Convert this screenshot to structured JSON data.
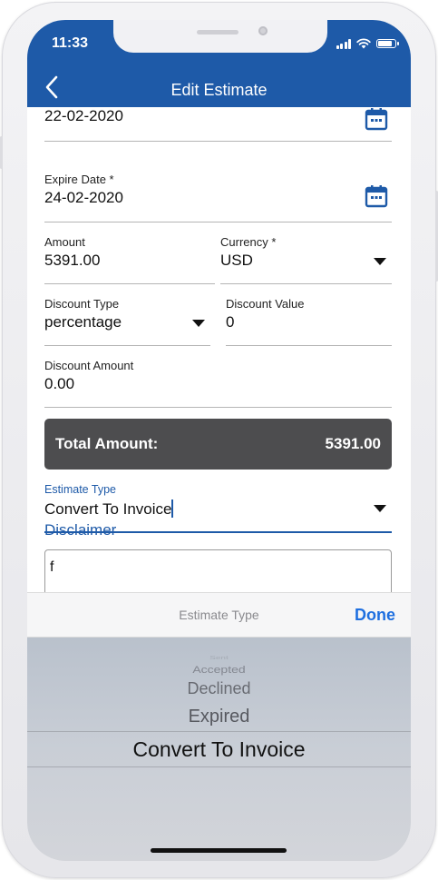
{
  "status_bar": {
    "time": "11:33"
  },
  "header": {
    "title": "Edit Estimate"
  },
  "form": {
    "start_date_value": "22-02-2020",
    "expire_date": {
      "label": "Expire Date *",
      "value": "24-02-2020"
    },
    "amount": {
      "label": "Amount",
      "value": "5391.00"
    },
    "currency": {
      "label": "Currency *",
      "value": "USD"
    },
    "discount_type": {
      "label": "Discount Type",
      "value": "percentage"
    },
    "discount_value": {
      "label": "Discount Value",
      "value": "0"
    },
    "discount_amount": {
      "label": "Discount Amount",
      "value": "0.00"
    },
    "total": {
      "label": "Total Amount:",
      "value": "5391.00"
    },
    "estimate_type": {
      "label": "Estimate Type",
      "value": "Convert To Invoice"
    },
    "disclaimer": {
      "label": "Disclaimer",
      "value": "f"
    }
  },
  "picker": {
    "toolbar_title": "Estimate Type",
    "done_label": "Done",
    "options": [
      "Sent",
      "Accepted",
      "Declined",
      "Expired",
      "Convert To Invoice"
    ],
    "selected": "Convert To Invoice"
  },
  "colors": {
    "header": "#1e5aa8",
    "accent": "#1e6fe0",
    "total_bg": "#4d4d4f"
  }
}
